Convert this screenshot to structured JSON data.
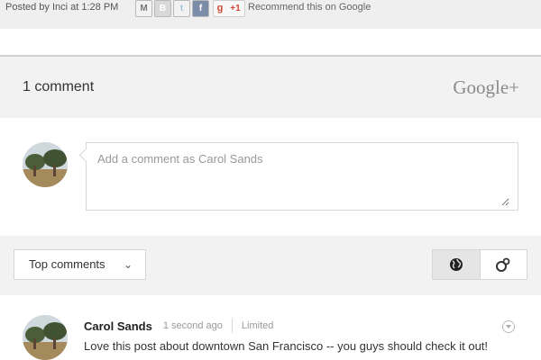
{
  "post_footer": {
    "posted_by": "Posted by Inci at 1:28 PM",
    "share_icons": [
      {
        "icon": "email-icon",
        "glyph": "M"
      },
      {
        "icon": "blogger-icon",
        "glyph": "B"
      },
      {
        "icon": "twitter-icon",
        "glyph": "t"
      },
      {
        "icon": "facebook-icon",
        "glyph": "f"
      }
    ],
    "plus_one": {
      "g": "g",
      "count": "+1"
    },
    "recommend_text": "Recommend this on Google"
  },
  "comments_header": {
    "count_label": "1 comment",
    "brand": "Google+"
  },
  "compose": {
    "placeholder": "Add a comment as Carol Sands"
  },
  "sort_bar": {
    "sort_label": "Top comments",
    "chevron": "⌄"
  },
  "comment": {
    "author": "Carol Sands",
    "time": "1 second ago",
    "visibility": "Limited",
    "text": "Love this post about downtown San Francisco -- you guys should check it out!"
  },
  "colors": {
    "band": "#f2f2f2",
    "google_red": "#d14836",
    "brand_gray": "#8a8a8a"
  }
}
